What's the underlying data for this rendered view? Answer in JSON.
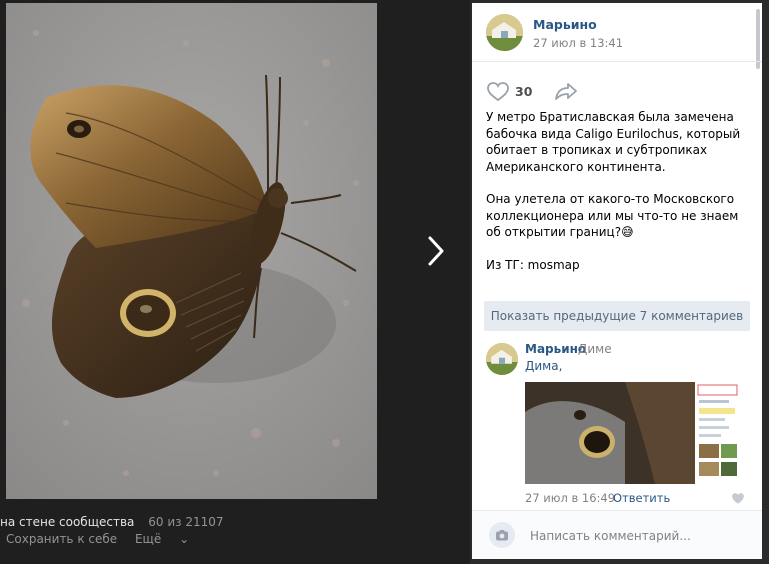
{
  "viewer": {
    "caption": "на стене сообщества",
    "counter": "60 из 21107",
    "actions": [
      "Сохранить к себе",
      "Ещё"
    ],
    "next_icon": "chevron-right-icon"
  },
  "post": {
    "author": "Марьино",
    "date": "27 июл в 13:41",
    "likes": "30",
    "paragraphs": [
      "У метро Братиславская была замечена бабочка вида Caligo Eurilochus, который обитает в тропиках и субтропиках Американского континента.",
      "Она улетела от какого-то Московского коллекционера или мы что-то не знаем об открытии границ?😅",
      "Из ТГ: mosmap"
    ]
  },
  "comments": {
    "show_previous": "Показать предыдущие 7 комментариев",
    "items": [
      {
        "author": "Марьино",
        "reply_to": "Диме",
        "text": "Дима,",
        "date": "27 июл в 16:49",
        "reply_label": "Ответить"
      }
    ]
  },
  "composer": {
    "placeholder": "Написать комментарий..."
  },
  "colors": {
    "link": "#2a5885",
    "button_bg": "#e5ebf1",
    "muted": "#828282"
  }
}
